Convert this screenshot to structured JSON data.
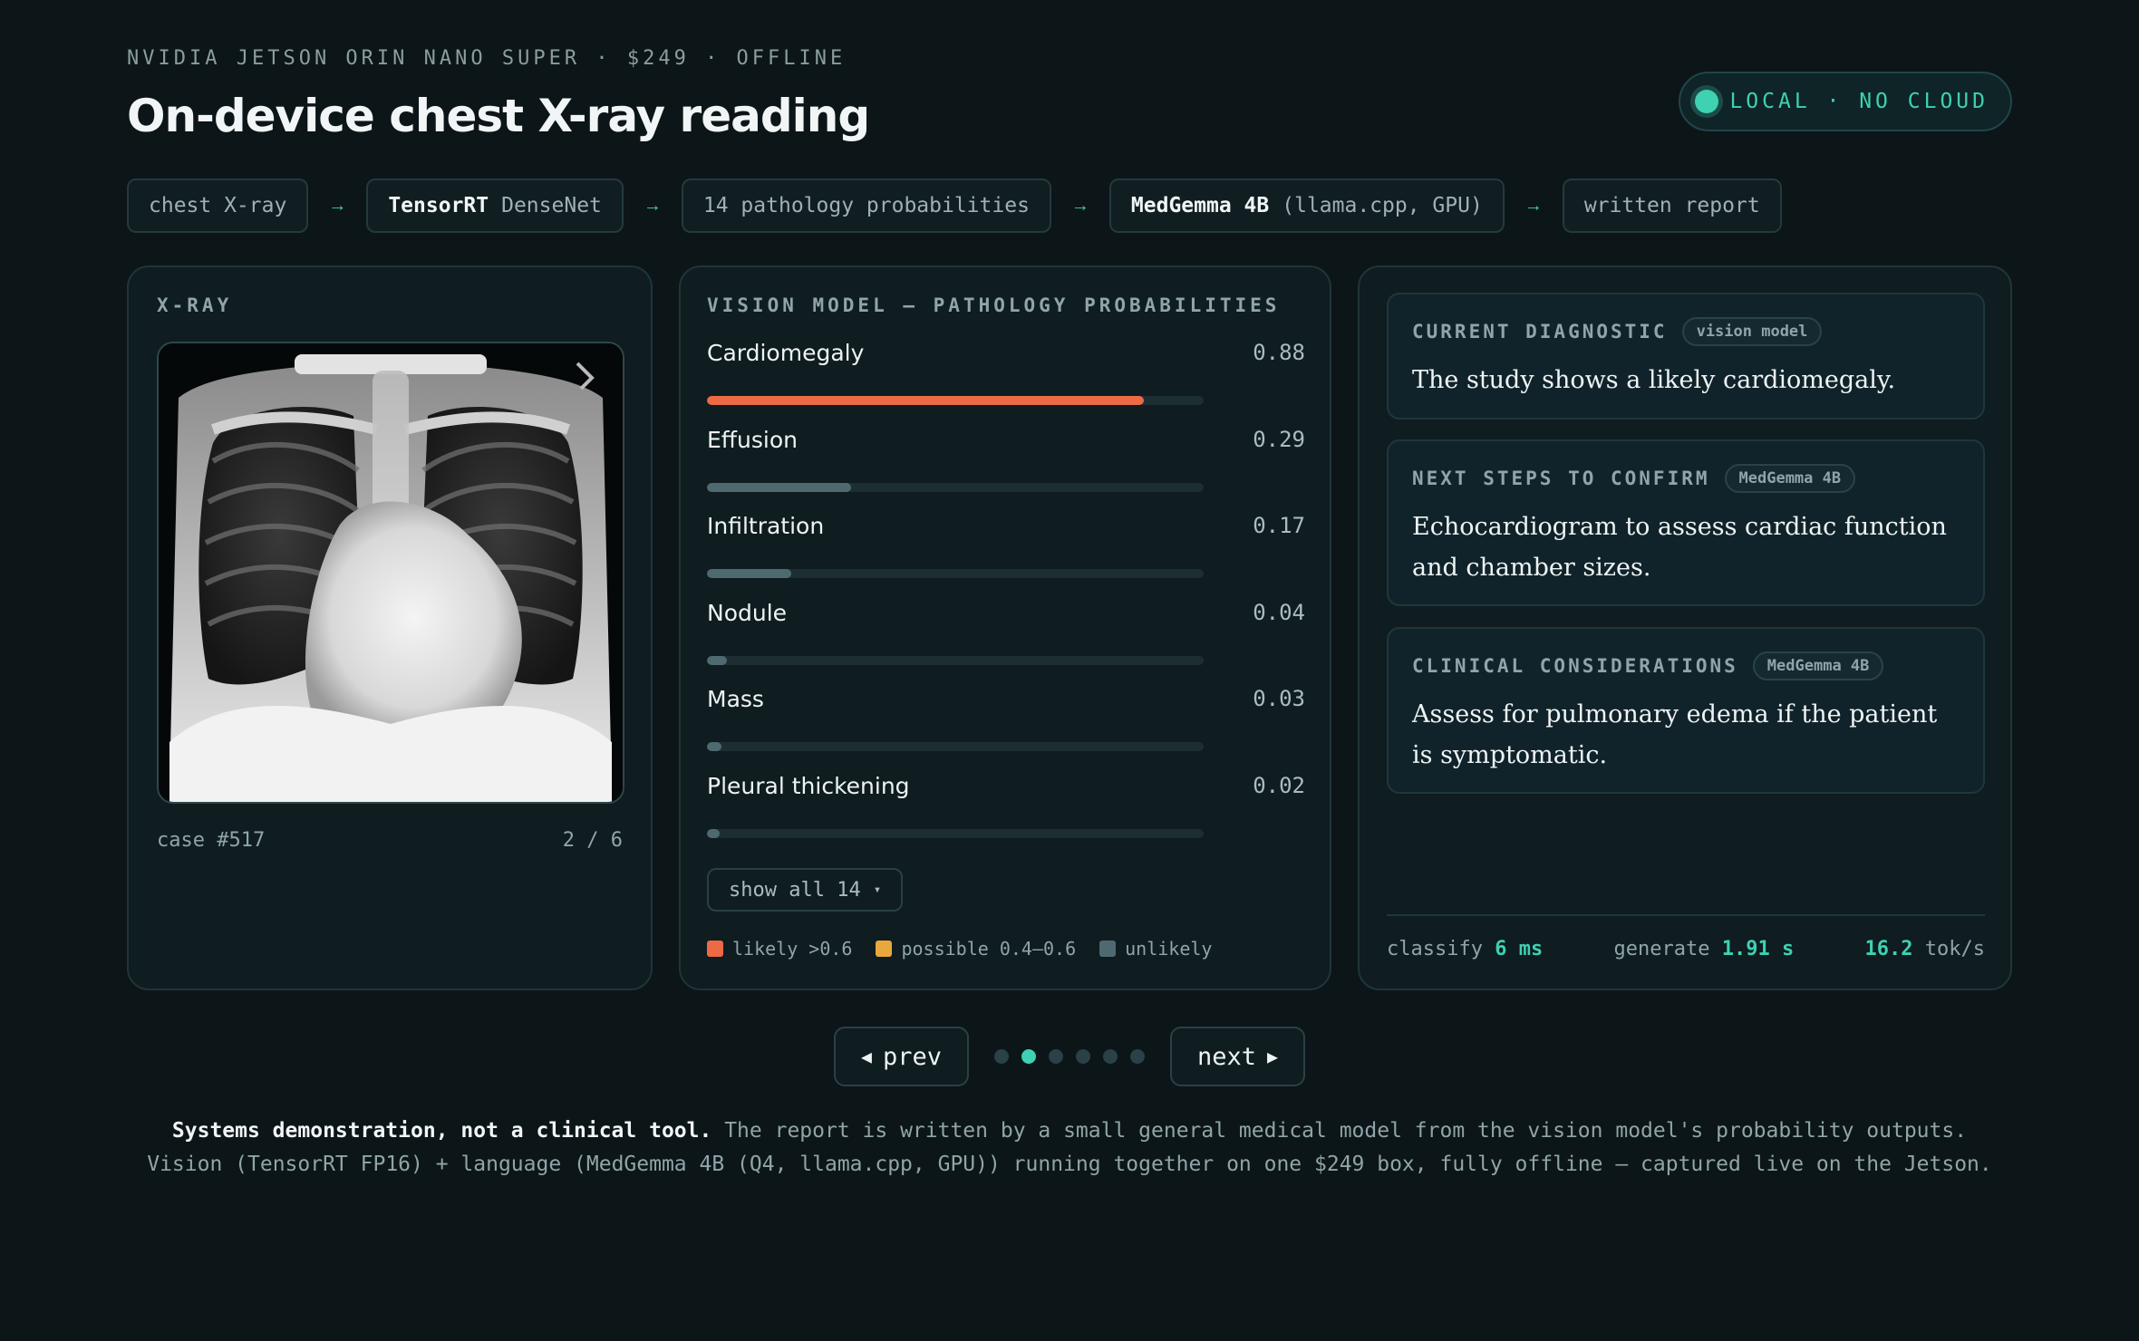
{
  "header": {
    "eyebrow": "NVIDIA JETSON ORIN NANO SUPER · $249 · OFFLINE",
    "title": "On-device chest X-ray reading",
    "badge": "LOCAL · NO CLOUD"
  },
  "pipeline": {
    "step1": "chest X-ray",
    "step2_bold": "TensorRT",
    "step2_rest": "DenseNet",
    "step3": "14 pathology probabilities",
    "step4_bold": "MedGemma 4B",
    "step4_rest": "(llama.cpp, GPU)",
    "step5": "written report",
    "arrow": "→"
  },
  "xray": {
    "label": "X-RAY",
    "case": "case #517",
    "position": "2 / 6"
  },
  "vision": {
    "label": "VISION MODEL — PATHOLOGY PROBABILITIES",
    "items": [
      {
        "name": "Cardiomegaly",
        "value": "0.88",
        "prob": 0.88,
        "level": "likely"
      },
      {
        "name": "Effusion",
        "value": "0.29",
        "prob": 0.29,
        "level": "unlikely"
      },
      {
        "name": "Infiltration",
        "value": "0.17",
        "prob": 0.17,
        "level": "unlikely"
      },
      {
        "name": "Nodule",
        "value": "0.04",
        "prob": 0.04,
        "level": "unlikely"
      },
      {
        "name": "Mass",
        "value": "0.03",
        "prob": 0.03,
        "level": "unlikely"
      },
      {
        "name": "Pleural thickening",
        "value": "0.02",
        "prob": 0.02,
        "level": "unlikely"
      }
    ],
    "show_all": "show all 14",
    "caret": "▾",
    "legend": {
      "likely": "likely >0.6",
      "possible": "possible 0.4–0.6",
      "unlikely": "unlikely"
    }
  },
  "report": {
    "diagnostic": {
      "title": "CURRENT DIAGNOSTIC",
      "tag": "vision model",
      "text": "The study shows a likely cardiomegaly."
    },
    "next_steps": {
      "title": "NEXT STEPS TO CONFIRM",
      "tag": "MedGemma 4B",
      "text": "Echocardiogram to assess cardiac function and chamber sizes."
    },
    "considerations": {
      "title": "CLINICAL CONSIDERATIONS",
      "tag": "MedGemma 4B",
      "text": "Assess for pulmonary edema if the patient is symptomatic."
    },
    "stats": {
      "classify_label": "classify",
      "classify_value": "6 ms",
      "generate_label": "generate",
      "generate_value": "1.91 s",
      "rate_value": "16.2",
      "rate_label": "tok/s"
    }
  },
  "pager": {
    "prev": "prev",
    "next": "next",
    "prev_icon": "◀",
    "next_icon": "▶",
    "total": 6,
    "active": 2
  },
  "footer": {
    "bold": "Systems demonstration, not a clinical tool.",
    "line1_rest": "The report is written by a small general medical model from the vision model's probability outputs.",
    "line2": "Vision (TensorRT FP16) + language (MedGemma 4B (Q4, llama.cpp, GPU)) running together on one $249 box, fully offline — captured live on the Jetson."
  },
  "colors": {
    "accent": "#3ed1b2",
    "likely": "#ec6a45",
    "possible": "#e8a83c",
    "unlikely": "#4e6a70"
  }
}
